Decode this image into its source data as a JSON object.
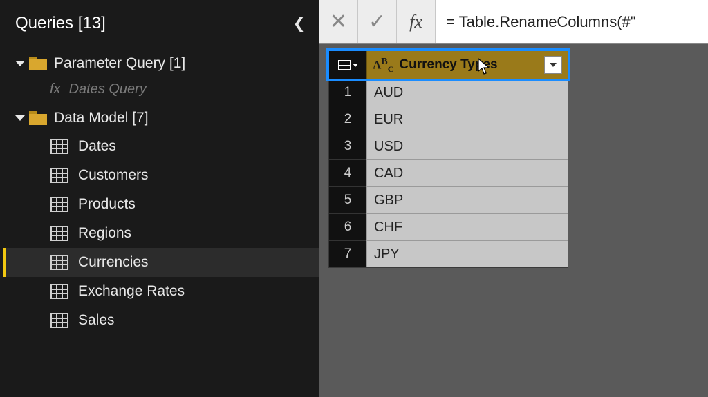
{
  "sidebar": {
    "title": "Queries [13]",
    "groups": [
      {
        "label": "Parameter Query [1]",
        "fx_child": "Dates Query"
      },
      {
        "label": "Data Model [7]"
      }
    ],
    "queries": [
      {
        "label": "Dates",
        "selected": false
      },
      {
        "label": "Customers",
        "selected": false
      },
      {
        "label": "Products",
        "selected": false
      },
      {
        "label": "Regions",
        "selected": false
      },
      {
        "label": "Currencies",
        "selected": true
      },
      {
        "label": "Exchange Rates",
        "selected": false
      },
      {
        "label": "Sales",
        "selected": false
      }
    ]
  },
  "formula": "= Table.RenameColumns(#\"",
  "table": {
    "column_header": "Currency Types",
    "rows": [
      "AUD",
      "EUR",
      "USD",
      "CAD",
      "GBP",
      "CHF",
      "JPY"
    ]
  }
}
